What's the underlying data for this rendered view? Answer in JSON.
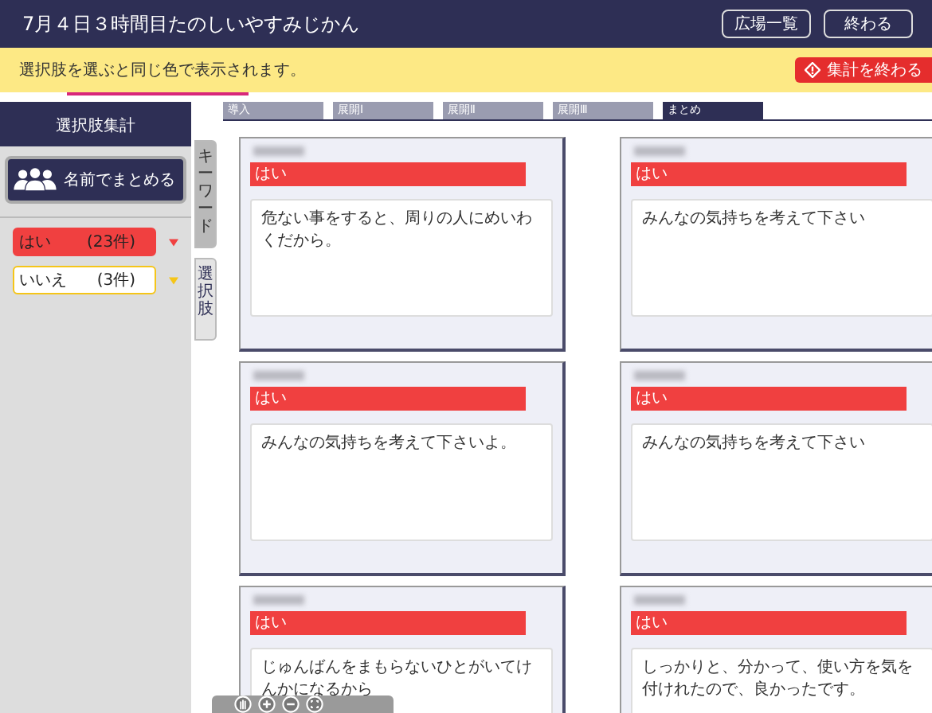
{
  "header": {
    "title": "7月４日３時間目たのしいやすみじかん",
    "buttons": [
      "広場一覧",
      "終わる"
    ]
  },
  "notice": {
    "text": "選択肢を選ぶと同じ色で表示されます。",
    "button": "集計を終わる"
  },
  "sidebar": {
    "title": "選択肢集計",
    "group_button": "名前でまとめる",
    "items": [
      {
        "label": "はい",
        "count": "(23件)",
        "color": "#f04040",
        "selected": true
      },
      {
        "label": "いいえ",
        "count": "(3件)",
        "color": "#f5c518",
        "selected": false
      }
    ]
  },
  "side_tabs": [
    {
      "label": "キーワード",
      "selected": true
    },
    {
      "label": "選択肢",
      "selected": false
    }
  ],
  "tabs": [
    {
      "label": "導入",
      "selected": false
    },
    {
      "label": "展開Ⅰ",
      "selected": false
    },
    {
      "label": "展開Ⅱ",
      "selected": false
    },
    {
      "label": "展開Ⅲ",
      "selected": false
    },
    {
      "label": "まとめ",
      "selected": true
    }
  ],
  "cards": [
    {
      "choice": "はい",
      "color": "#f04040",
      "answer": "危ない事をすると、周りの人にめいわくだから。"
    },
    {
      "choice": "はい",
      "color": "#f04040",
      "answer": "みんなの気持ちを考えて下さい"
    },
    {
      "choice": "はい",
      "color": "#f04040",
      "answer": "みんなの気持ちを考えて下さいよ。"
    },
    {
      "choice": "はい",
      "color": "#f04040",
      "answer": "みんなの気持ちを考えて下さい"
    },
    {
      "choice": "はい",
      "color": "#f04040",
      "answer": "じゅんばんをまもらないひとがいてけんかになるから"
    },
    {
      "choice": "はい",
      "color": "#f04040",
      "answer": "しっかりと、分かって、使い方を気を付けれたので、良かったです。"
    }
  ]
}
